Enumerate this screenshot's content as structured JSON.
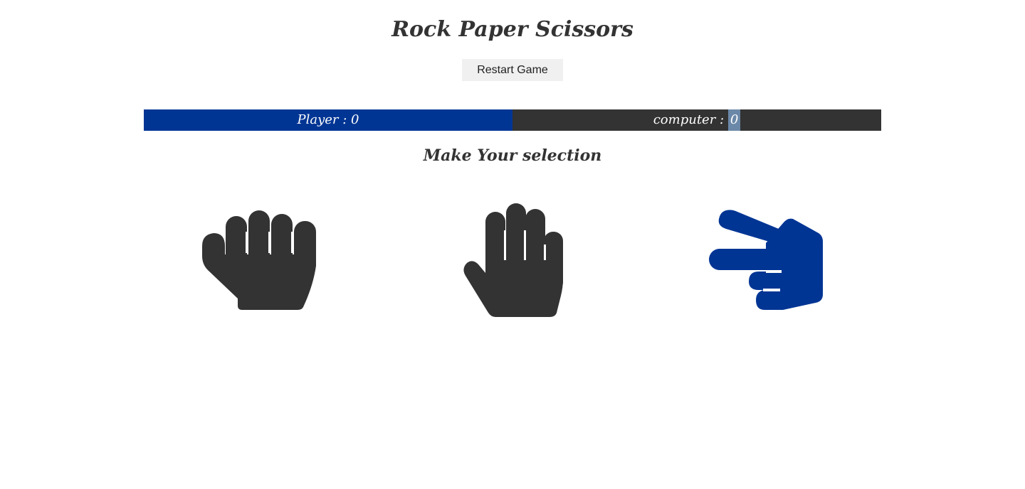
{
  "game": {
    "title": "Rock Paper Scissors",
    "restart_label": "Restart Game",
    "prompt": "Make Your selection"
  },
  "scoreboard": {
    "player_label": "Player : ",
    "player_score": "0",
    "computer_label": "computer : ",
    "computer_score": "0"
  },
  "choices": [
    {
      "name": "rock",
      "icon": "hand-rock-icon",
      "color": "#333333",
      "selected": false
    },
    {
      "name": "paper",
      "icon": "hand-paper-icon",
      "color": "#333333",
      "selected": false
    },
    {
      "name": "scissors",
      "icon": "hand-scissors-icon",
      "color": "#003594",
      "selected": true
    }
  ],
  "colors": {
    "player_bar": "#003594",
    "computer_bar": "#333333",
    "text": "#333333",
    "selected": "#003594"
  }
}
